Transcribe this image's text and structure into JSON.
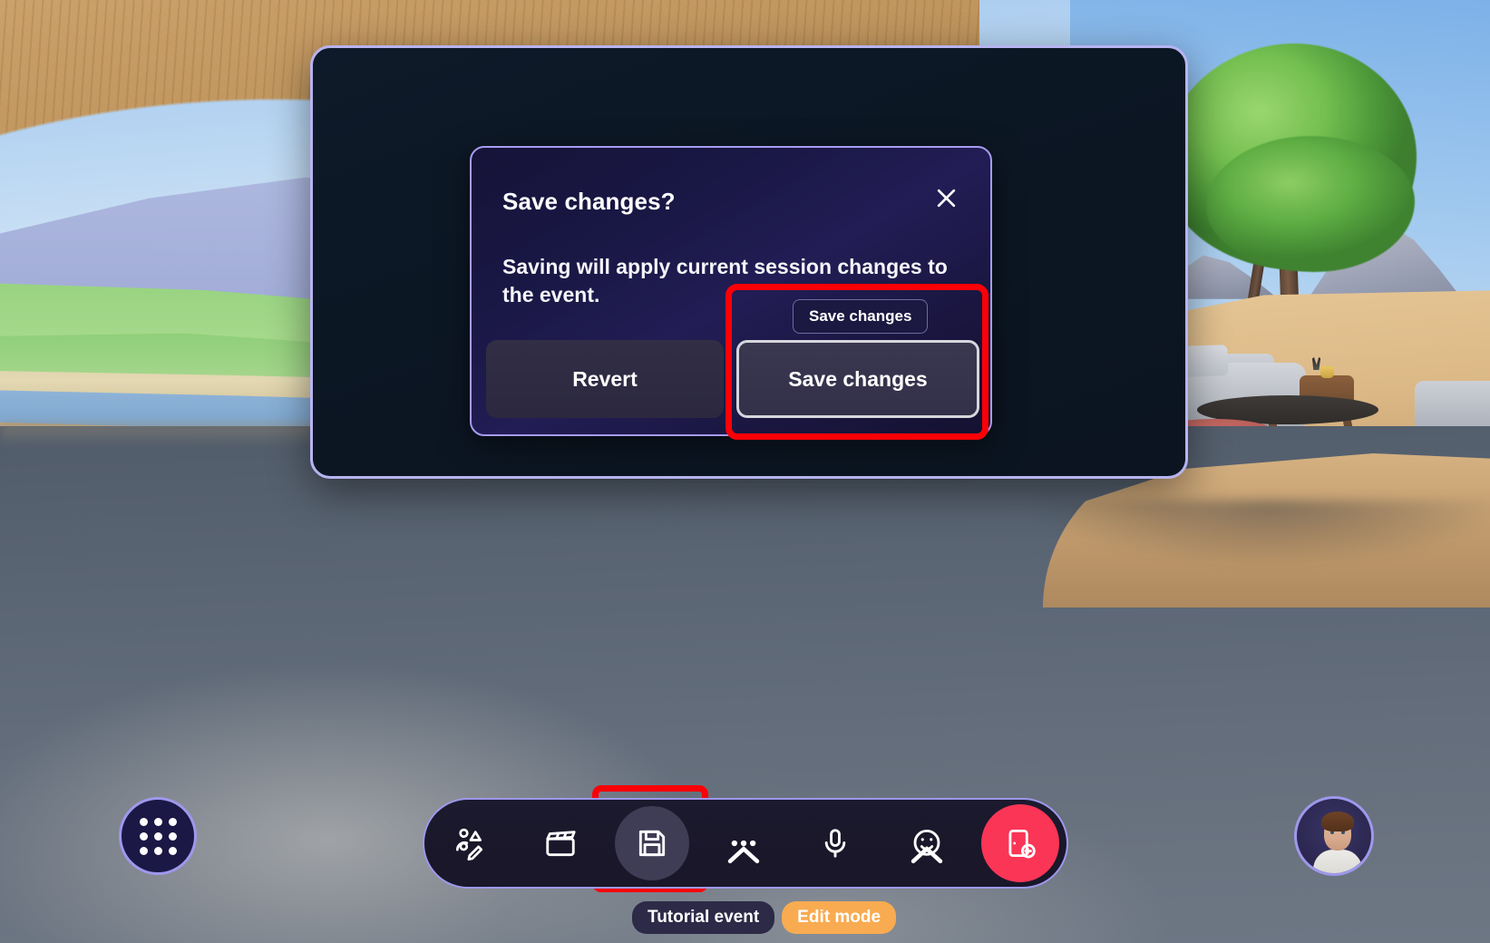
{
  "dialog": {
    "title": "Save changes?",
    "body": "Saving will apply current session changes to the event.",
    "revert_label": "Revert",
    "save_label": "Save changes",
    "tooltip_label": "Save changes",
    "close_icon": "close-icon",
    "border_color": "#a79bf0"
  },
  "toolbar": {
    "buttons": [
      {
        "name": "avatar-customize-button",
        "icon": "avatar-edit-icon",
        "has_caret": false,
        "active": false
      },
      {
        "name": "scene-clapperboard-button",
        "icon": "clapperboard-icon",
        "has_caret": false,
        "active": false
      },
      {
        "name": "save-button",
        "icon": "floppy-save-icon",
        "has_caret": false,
        "active": true
      },
      {
        "name": "more-options-button",
        "icon": "ellipsis-icon",
        "has_caret": true,
        "active": false
      },
      {
        "name": "microphone-button",
        "icon": "microphone-icon",
        "has_caret": false,
        "active": false
      },
      {
        "name": "reactions-button",
        "icon": "smiley-icon",
        "has_caret": true,
        "active": false
      },
      {
        "name": "leave-button",
        "icon": "door-exit-icon",
        "has_caret": false,
        "active": false
      }
    ],
    "leave_color": "#fa3556",
    "border_color": "#9e98ec"
  },
  "launcher": {
    "name": "app-launcher-button",
    "icon": "grid-dots-icon"
  },
  "avatar": {
    "name": "user-avatar",
    "label": ""
  },
  "status": {
    "event_label": "Tutorial event",
    "mode_label": "Edit mode",
    "mode_color": "#f8ab51"
  },
  "highlights": {
    "color": "#fb0007",
    "regions": [
      "save-changes-button",
      "toolbar-save-button"
    ]
  }
}
